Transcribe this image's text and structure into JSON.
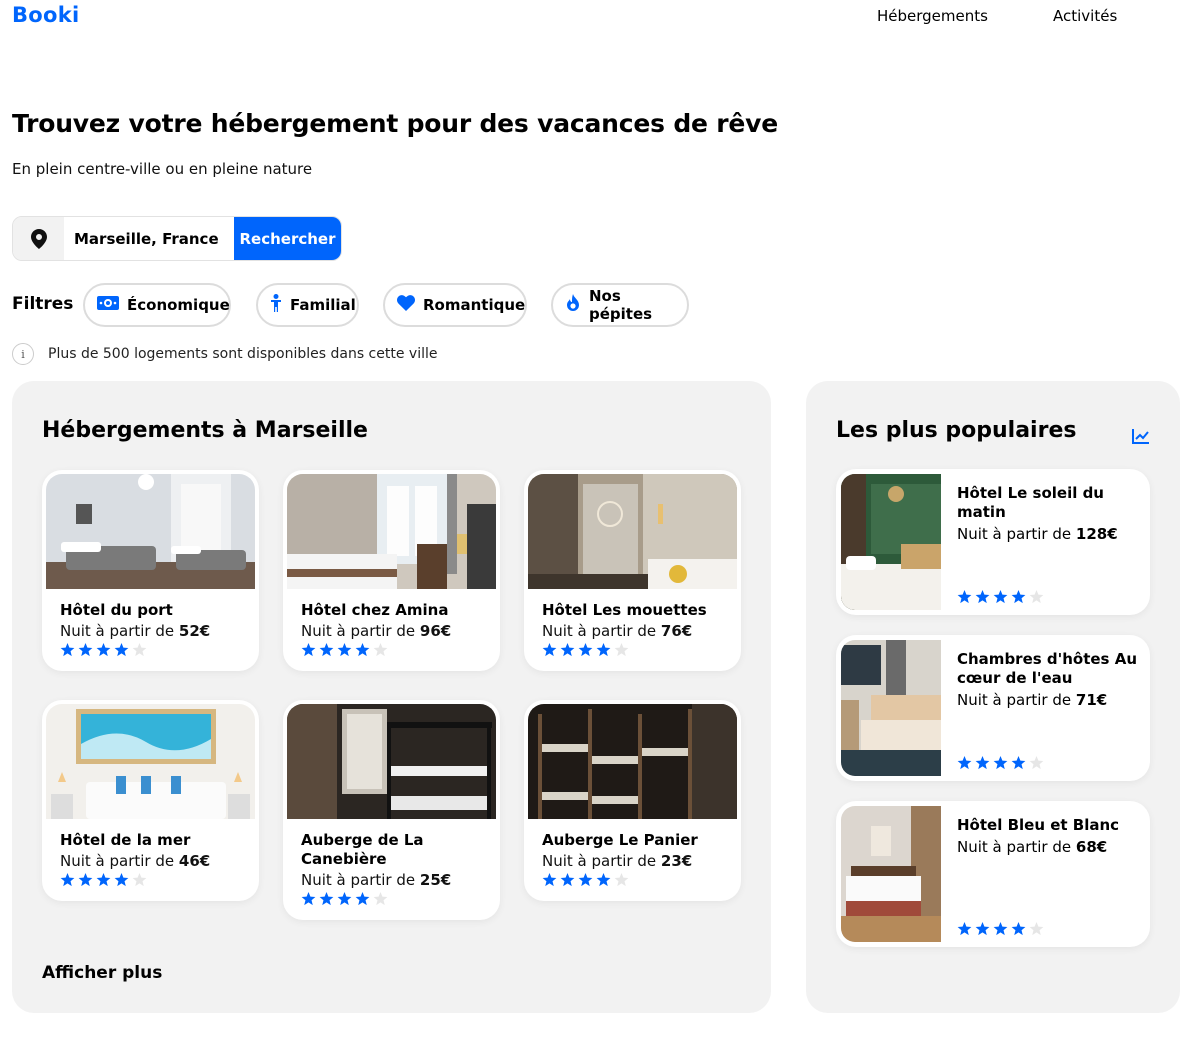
{
  "header": {
    "logo": "Booki",
    "nav": [
      "Hébergements",
      "Activités"
    ]
  },
  "hero": {
    "title": "Trouvez votre hébergement pour des vacances de rêve",
    "subtitle": "En plein centre-ville ou en pleine nature"
  },
  "search": {
    "value": "Marseille, France",
    "button": "Rechercher"
  },
  "filters": {
    "label": "Filtres",
    "items": [
      "Économique",
      "Familial",
      "Romantique",
      "Nos pépites"
    ]
  },
  "info": {
    "icon": "info-icon",
    "text": "Plus de 500 logements sont disponibles dans cette ville"
  },
  "accommodations": {
    "title": "Hébergements à Marseille",
    "more": "Afficher plus",
    "price_prefix": "Nuit à partir de",
    "items": [
      {
        "name": "Hôtel du port",
        "price": "52€",
        "stars": 4
      },
      {
        "name": "Hôtel chez Amina",
        "price": "96€",
        "stars": 4
      },
      {
        "name": "Hôtel Les mouettes",
        "price": "76€",
        "stars": 4
      },
      {
        "name": "Hôtel de la mer",
        "price": "46€",
        "stars": 4
      },
      {
        "name": "Auberge de La Canebière",
        "price": "25€",
        "stars": 4
      },
      {
        "name": "Auberge Le Panier",
        "price": "23€",
        "stars": 4
      }
    ]
  },
  "popular": {
    "title": "Les plus populaires",
    "icon": "trending-icon",
    "price_prefix": "Nuit à partir de",
    "items": [
      {
        "name": "Hôtel Le soleil du matin",
        "price": "128€",
        "stars": 4
      },
      {
        "name": "Chambres d'hôtes Au cœur de l'eau",
        "price": "71€",
        "stars": 4
      },
      {
        "name": "Hôtel Bleu et Blanc",
        "price": "68€",
        "stars": 4
      }
    ]
  },
  "colors": {
    "accent": "#0065FC",
    "panel": "#F2F2F2"
  }
}
